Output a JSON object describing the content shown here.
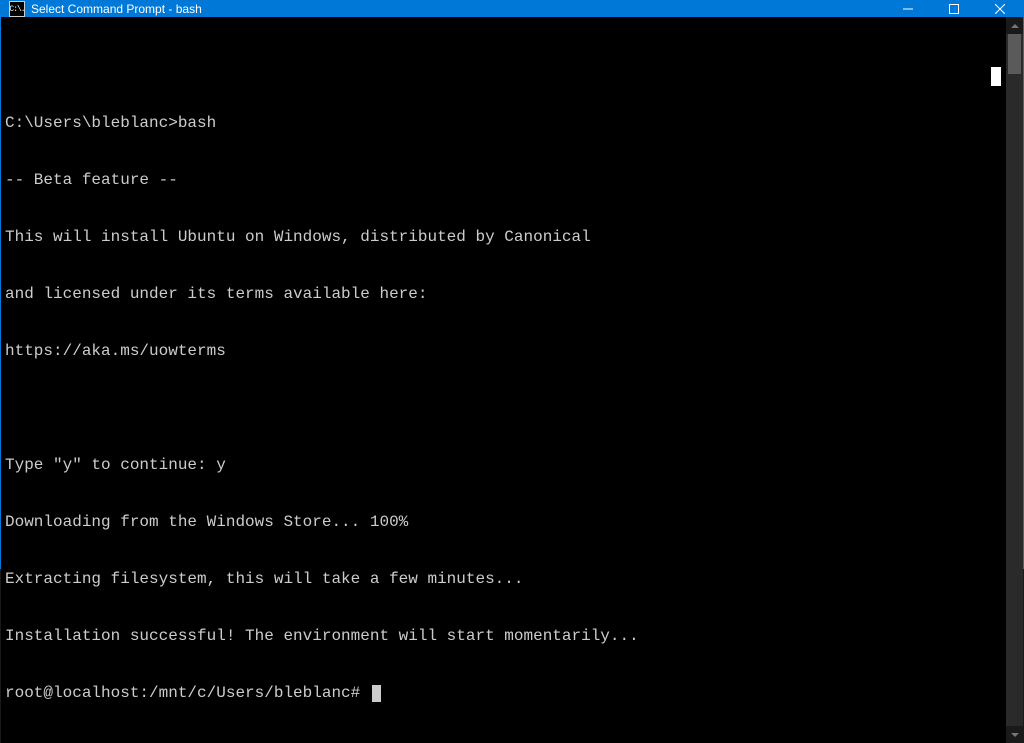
{
  "window": {
    "title": "Select Command Prompt - bash",
    "icon_text": "C:\\."
  },
  "terminal": {
    "lines": [
      "",
      "C:\\Users\\bleblanc>bash",
      "-- Beta feature --",
      "This will install Ubuntu on Windows, distributed by Canonical",
      "and licensed under its terms available here:",
      "https://aka.ms/uowterms",
      "",
      "Type \"y\" to continue: y",
      "Downloading from the Windows Store... 100%",
      "Extracting filesystem, this will take a few minutes...",
      "Installation successful! The environment will start momentarily...",
      "root@localhost:/mnt/c/Users/bleblanc# "
    ]
  }
}
